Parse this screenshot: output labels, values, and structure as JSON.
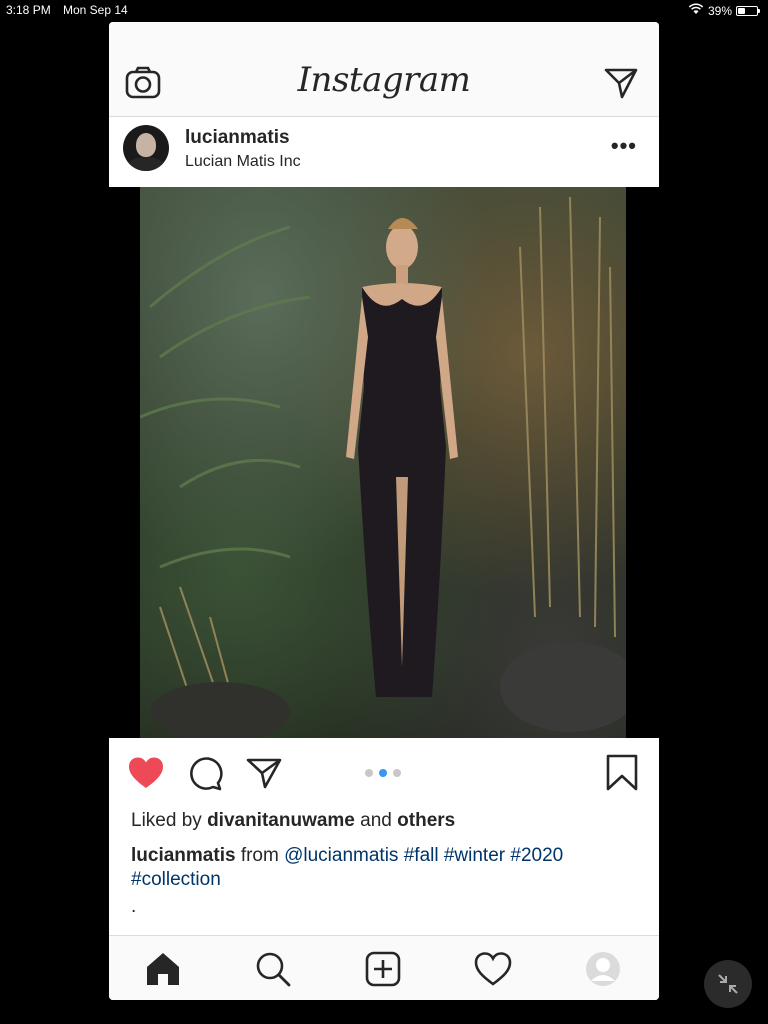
{
  "status_bar": {
    "time": "3:18 PM",
    "date": "Mon Sep 14",
    "battery_percent": "39%",
    "battery_level": 0.39,
    "icons": [
      "wifi-icon",
      "battery-icon"
    ]
  },
  "app": {
    "logo_text": "Instagram",
    "top_icons": [
      "camera-icon",
      "direct-send-icon"
    ]
  },
  "post": {
    "username": "lucianmatis",
    "subtitle": "Lucian Matis Inc",
    "more_label": "•••",
    "image_description": "",
    "carousel": {
      "count": 3,
      "active_index": 1
    },
    "liked": true,
    "likes": {
      "prefix": "Liked by",
      "user": "divanitanuwame",
      "connector": "and",
      "others": "others"
    },
    "caption": {
      "user": "lucianmatis",
      "text": "from",
      "mention": "@lucianmatis",
      "hashtags": [
        "#fall",
        "#winter",
        "#2020",
        "#collection"
      ]
    },
    "more_text": "."
  },
  "bottom_nav": {
    "items": [
      "home-icon",
      "search-icon",
      "add-post-icon",
      "activity-heart-icon",
      "profile-icon"
    ]
  },
  "colors": {
    "like_red": "#ed4956",
    "link_blue": "#003569",
    "carousel_active": "#3897f0",
    "text": "#262626"
  }
}
